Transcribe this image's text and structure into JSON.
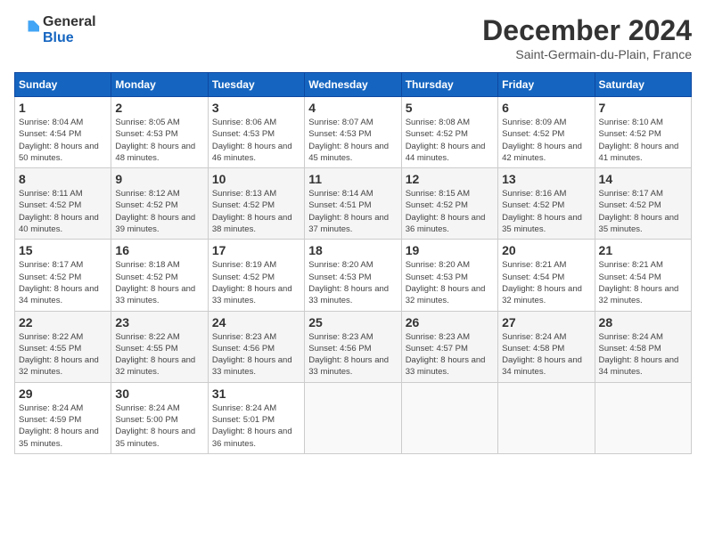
{
  "header": {
    "logo_line1": "General",
    "logo_line2": "Blue",
    "month_title": "December 2024",
    "location": "Saint-Germain-du-Plain, France"
  },
  "days_of_week": [
    "Sunday",
    "Monday",
    "Tuesday",
    "Wednesday",
    "Thursday",
    "Friday",
    "Saturday"
  ],
  "weeks": [
    [
      {
        "day": "1",
        "sunrise": "8:04 AM",
        "sunset": "4:54 PM",
        "daylight": "8 hours and 50 minutes."
      },
      {
        "day": "2",
        "sunrise": "8:05 AM",
        "sunset": "4:53 PM",
        "daylight": "8 hours and 48 minutes."
      },
      {
        "day": "3",
        "sunrise": "8:06 AM",
        "sunset": "4:53 PM",
        "daylight": "8 hours and 46 minutes."
      },
      {
        "day": "4",
        "sunrise": "8:07 AM",
        "sunset": "4:53 PM",
        "daylight": "8 hours and 45 minutes."
      },
      {
        "day": "5",
        "sunrise": "8:08 AM",
        "sunset": "4:52 PM",
        "daylight": "8 hours and 44 minutes."
      },
      {
        "day": "6",
        "sunrise": "8:09 AM",
        "sunset": "4:52 PM",
        "daylight": "8 hours and 42 minutes."
      },
      {
        "day": "7",
        "sunrise": "8:10 AM",
        "sunset": "4:52 PM",
        "daylight": "8 hours and 41 minutes."
      }
    ],
    [
      {
        "day": "8",
        "sunrise": "8:11 AM",
        "sunset": "4:52 PM",
        "daylight": "8 hours and 40 minutes."
      },
      {
        "day": "9",
        "sunrise": "8:12 AM",
        "sunset": "4:52 PM",
        "daylight": "8 hours and 39 minutes."
      },
      {
        "day": "10",
        "sunrise": "8:13 AM",
        "sunset": "4:52 PM",
        "daylight": "8 hours and 38 minutes."
      },
      {
        "day": "11",
        "sunrise": "8:14 AM",
        "sunset": "4:51 PM",
        "daylight": "8 hours and 37 minutes."
      },
      {
        "day": "12",
        "sunrise": "8:15 AM",
        "sunset": "4:52 PM",
        "daylight": "8 hours and 36 minutes."
      },
      {
        "day": "13",
        "sunrise": "8:16 AM",
        "sunset": "4:52 PM",
        "daylight": "8 hours and 35 minutes."
      },
      {
        "day": "14",
        "sunrise": "8:17 AM",
        "sunset": "4:52 PM",
        "daylight": "8 hours and 35 minutes."
      }
    ],
    [
      {
        "day": "15",
        "sunrise": "8:17 AM",
        "sunset": "4:52 PM",
        "daylight": "8 hours and 34 minutes."
      },
      {
        "day": "16",
        "sunrise": "8:18 AM",
        "sunset": "4:52 PM",
        "daylight": "8 hours and 33 minutes."
      },
      {
        "day": "17",
        "sunrise": "8:19 AM",
        "sunset": "4:52 PM",
        "daylight": "8 hours and 33 minutes."
      },
      {
        "day": "18",
        "sunrise": "8:20 AM",
        "sunset": "4:53 PM",
        "daylight": "8 hours and 33 minutes."
      },
      {
        "day": "19",
        "sunrise": "8:20 AM",
        "sunset": "4:53 PM",
        "daylight": "8 hours and 32 minutes."
      },
      {
        "day": "20",
        "sunrise": "8:21 AM",
        "sunset": "4:54 PM",
        "daylight": "8 hours and 32 minutes."
      },
      {
        "day": "21",
        "sunrise": "8:21 AM",
        "sunset": "4:54 PM",
        "daylight": "8 hours and 32 minutes."
      }
    ],
    [
      {
        "day": "22",
        "sunrise": "8:22 AM",
        "sunset": "4:55 PM",
        "daylight": "8 hours and 32 minutes."
      },
      {
        "day": "23",
        "sunrise": "8:22 AM",
        "sunset": "4:55 PM",
        "daylight": "8 hours and 32 minutes."
      },
      {
        "day": "24",
        "sunrise": "8:23 AM",
        "sunset": "4:56 PM",
        "daylight": "8 hours and 33 minutes."
      },
      {
        "day": "25",
        "sunrise": "8:23 AM",
        "sunset": "4:56 PM",
        "daylight": "8 hours and 33 minutes."
      },
      {
        "day": "26",
        "sunrise": "8:23 AM",
        "sunset": "4:57 PM",
        "daylight": "8 hours and 33 minutes."
      },
      {
        "day": "27",
        "sunrise": "8:24 AM",
        "sunset": "4:58 PM",
        "daylight": "8 hours and 34 minutes."
      },
      {
        "day": "28",
        "sunrise": "8:24 AM",
        "sunset": "4:58 PM",
        "daylight": "8 hours and 34 minutes."
      }
    ],
    [
      {
        "day": "29",
        "sunrise": "8:24 AM",
        "sunset": "4:59 PM",
        "daylight": "8 hours and 35 minutes."
      },
      {
        "day": "30",
        "sunrise": "8:24 AM",
        "sunset": "5:00 PM",
        "daylight": "8 hours and 35 minutes."
      },
      {
        "day": "31",
        "sunrise": "8:24 AM",
        "sunset": "5:01 PM",
        "daylight": "8 hours and 36 minutes."
      },
      null,
      null,
      null,
      null
    ]
  ],
  "labels": {
    "sunrise_prefix": "Sunrise: ",
    "sunset_prefix": "Sunset: ",
    "daylight_prefix": "Daylight: "
  }
}
